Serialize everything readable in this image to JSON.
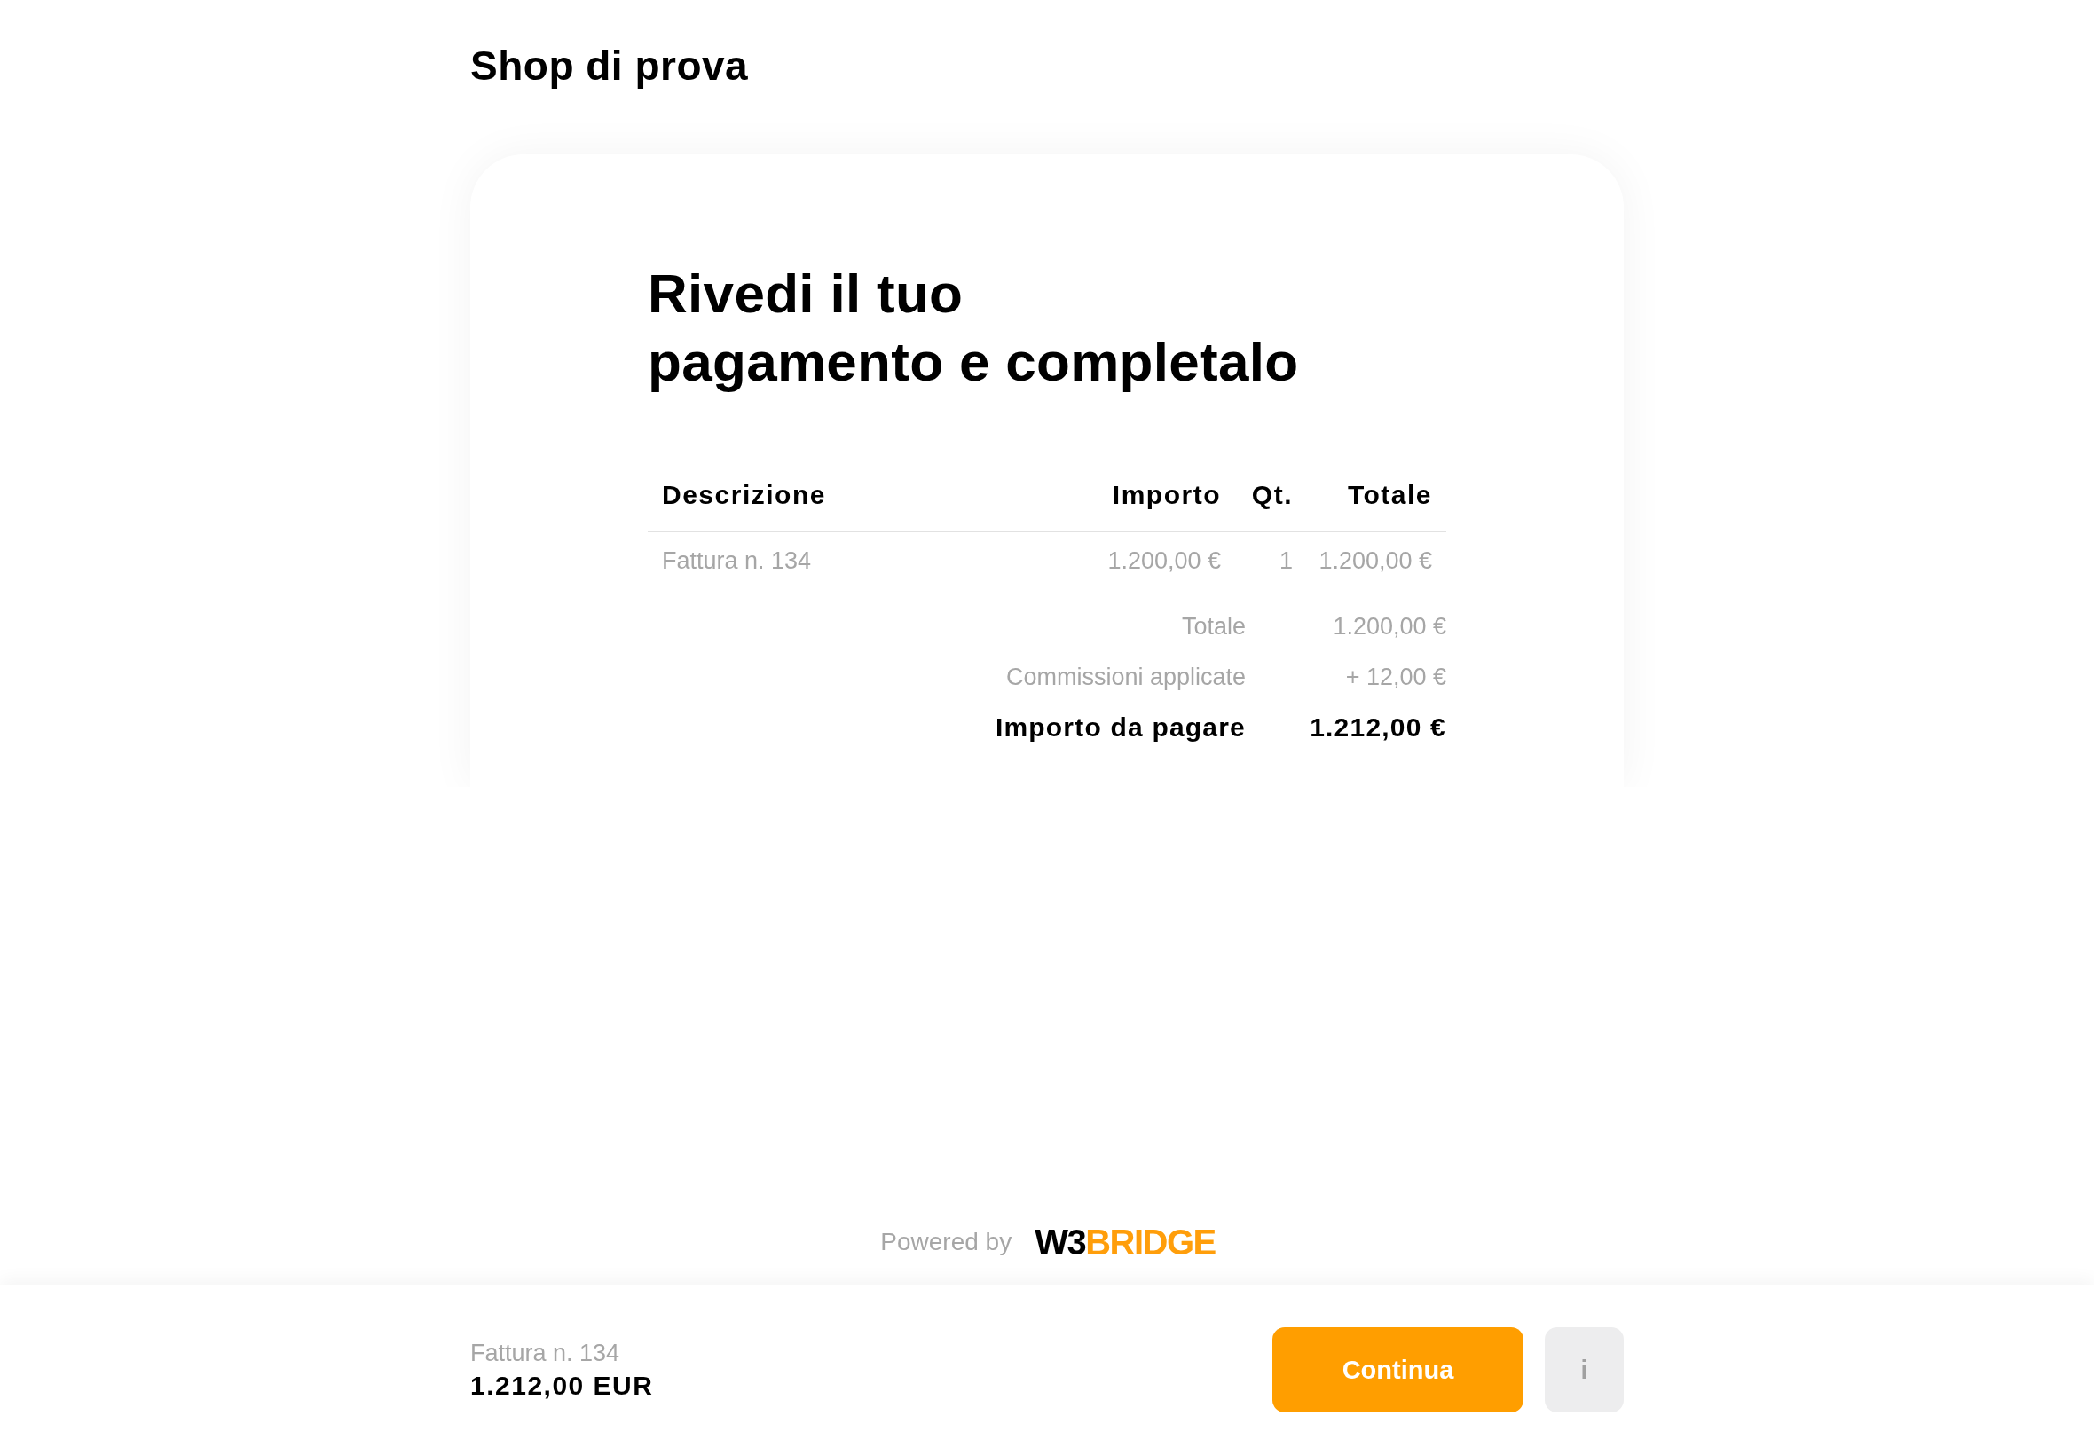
{
  "shop_name": "Shop di prova",
  "heading_lines": [
    "Rivedi il tuo",
    "pagamento e completalo"
  ],
  "table": {
    "columns": [
      "Descrizione",
      "Importo",
      "Qt.",
      "Totale"
    ],
    "rows": [
      [
        "Fattura n. 134",
        "1.200,00 €",
        "1",
        "1.200,00 €"
      ]
    ]
  },
  "summary": [
    {
      "kind": "subtotal",
      "label": "Totale",
      "value": "1.200,00 €"
    },
    {
      "kind": "fee",
      "label": "Commissioni applicate",
      "value": "+ 12,00 €"
    },
    {
      "kind": "due",
      "label": "Importo da pagare",
      "value": "1.212,00 €"
    }
  ],
  "footer": {
    "powered_by": "Powered by",
    "logo": {
      "dark": "W3",
      "accent": "BRIDGE"
    }
  },
  "bottom_bar": {
    "description": "Fattura n. 134",
    "amount": "1.212,00 EUR",
    "primary_button": "Continua",
    "info_button": "i"
  }
}
